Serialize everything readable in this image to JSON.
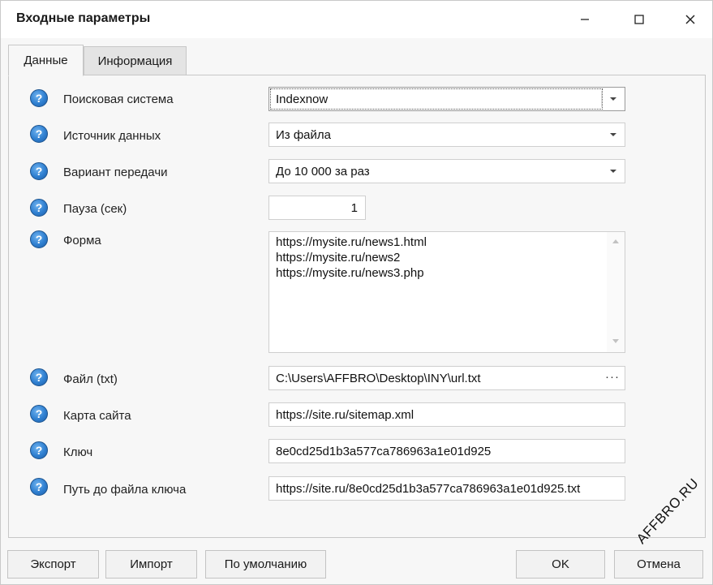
{
  "window": {
    "title": "Входные параметры",
    "controls": {
      "minimize_icon": "minimize-icon",
      "maximize_icon": "maximize-icon",
      "close_icon": "close-icon"
    }
  },
  "tabs": [
    {
      "label": "Данные",
      "active": true
    },
    {
      "label": "Информация",
      "active": false
    }
  ],
  "form": {
    "help_glyph": "?",
    "search_engine": {
      "label": "Поисковая система",
      "value": "Indexnow"
    },
    "data_source": {
      "label": "Источник данных",
      "value": "Из файла"
    },
    "transfer_mode": {
      "label": "Вариант передачи",
      "value": "До 10 000 за раз"
    },
    "pause": {
      "label": "Пауза (сек)",
      "value": "1"
    },
    "form_urls": {
      "label": "Форма",
      "lines": [
        "https://mysite.ru/news1.html",
        "https://mysite.ru/news2",
        "https://mysite.ru/news3.php"
      ]
    },
    "file": {
      "label": "Файл (txt)",
      "value": "C:\\Users\\AFFBRO\\Desktop\\INY\\url.txt",
      "browse_glyph": "···"
    },
    "sitemap": {
      "label": "Карта сайта",
      "value": "https://site.ru/sitemap.xml"
    },
    "key": {
      "label": "Ключ",
      "value": "8e0cd25d1b3a577ca786963a1e01d925"
    },
    "key_path": {
      "label": "Путь до файла ключа",
      "value": "https://site.ru/8e0cd25d1b3a577ca786963a1e01d925.txt"
    }
  },
  "buttons": {
    "export": "Экспорт",
    "import": "Импорт",
    "defaults": "По умолчанию",
    "ok": "OK",
    "cancel": "Отмена"
  },
  "watermark": "AFFBRO.RU",
  "colors": {
    "help_icon": "#2f7fd0",
    "background": "#f7f7f7",
    "border": "#c7c7c7"
  }
}
